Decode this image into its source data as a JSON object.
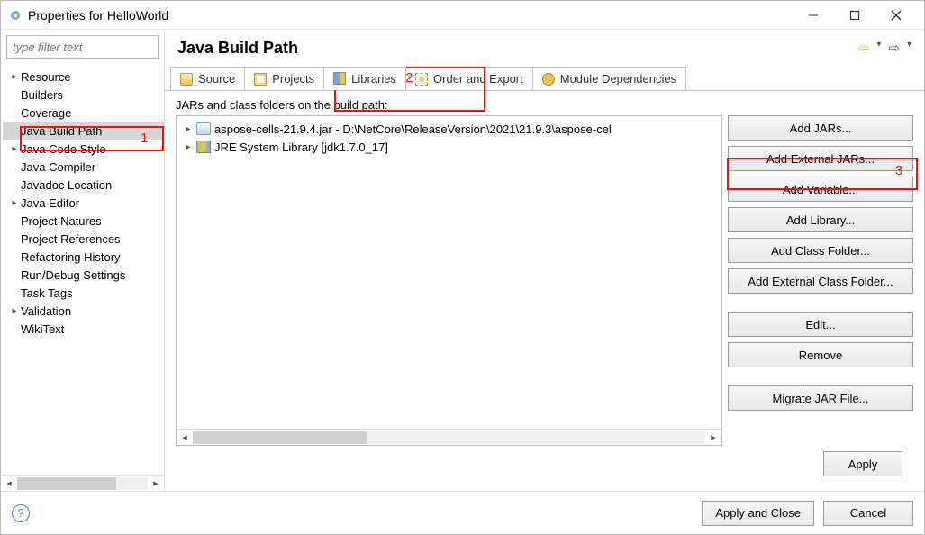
{
  "window": {
    "title": "Properties for HelloWorld"
  },
  "filter": {
    "placeholder": "type filter text"
  },
  "sidebar": {
    "items": [
      {
        "expandable": true,
        "label": "Resource"
      },
      {
        "expandable": false,
        "label": "Builders"
      },
      {
        "expandable": false,
        "label": "Coverage"
      },
      {
        "expandable": false,
        "label": "Java Build Path",
        "selected": true
      },
      {
        "expandable": true,
        "label": "Java Code Style"
      },
      {
        "expandable": false,
        "label": "Java Compiler"
      },
      {
        "expandable": false,
        "label": "Javadoc Location"
      },
      {
        "expandable": true,
        "label": "Java Editor"
      },
      {
        "expandable": false,
        "label": "Project Natures"
      },
      {
        "expandable": false,
        "label": "Project References"
      },
      {
        "expandable": false,
        "label": "Refactoring History"
      },
      {
        "expandable": false,
        "label": "Run/Debug Settings"
      },
      {
        "expandable": false,
        "label": "Task Tags"
      },
      {
        "expandable": true,
        "label": "Validation"
      },
      {
        "expandable": false,
        "label": "WikiText"
      }
    ]
  },
  "header": {
    "title": "Java Build Path"
  },
  "tabs": [
    {
      "label": "Source"
    },
    {
      "label": "Projects"
    },
    {
      "label": "Libraries",
      "active": true
    },
    {
      "label": "Order and Export"
    },
    {
      "label": "Module Dependencies"
    }
  ],
  "list": {
    "label": "JARs and class folders on the build path:",
    "items": [
      {
        "icon": "jar",
        "label": "aspose-cells-21.9.4.jar - D:\\NetCore\\ReleaseVersion\\2021\\21.9.3\\aspose-cel"
      },
      {
        "icon": "jre",
        "label": "JRE System Library [jdk1.7.0_17]"
      }
    ]
  },
  "buttons": {
    "add_jars": "Add JARs...",
    "add_external_jars": "Add External JARs...",
    "add_variable": "Add Variable...",
    "add_library": "Add Library...",
    "add_class_folder": "Add Class Folder...",
    "add_external_class_folder": "Add External Class Folder...",
    "edit": "Edit...",
    "remove": "Remove",
    "migrate_jar": "Migrate JAR File...",
    "apply": "Apply",
    "apply_and_close": "Apply and Close",
    "cancel": "Cancel"
  },
  "annotations": {
    "one": "1",
    "two": "2",
    "three": "3"
  }
}
